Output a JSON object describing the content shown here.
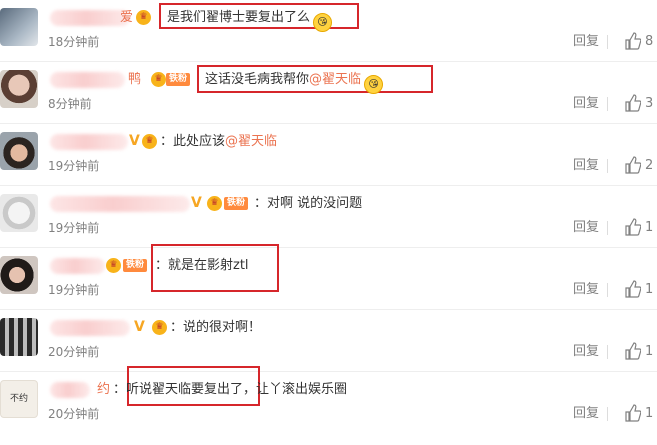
{
  "comments": [
    {
      "time": "18分钟前",
      "name_tail": "爱",
      "text_parts": [
        "是我们翟博士要复出了么"
      ],
      "emoji": "😘",
      "reply": "回复",
      "likes": "8",
      "highlighted": true
    },
    {
      "time": "8分钟前",
      "name_tail": "鸭",
      "fan_badge": "铁粉",
      "text_parts": [
        "这话没毛病我帮你"
      ],
      "mention": "@翟天临",
      "emoji": "😘",
      "reply": "回复",
      "likes": "3",
      "highlighted": true
    },
    {
      "time": "19分钟前",
      "name_tail": "V",
      "text_parts": [
        "：此处应该"
      ],
      "mention": "@翟天临",
      "reply": "回复",
      "likes": "2",
      "highlighted": false
    },
    {
      "time": "19分钟前",
      "name_tail": "V",
      "fan_badge": "铁粉",
      "text_parts": [
        "：对啊 说的没问题"
      ],
      "reply": "回复",
      "likes": "1",
      "highlighted": false
    },
    {
      "time": "19分钟前",
      "fan_badge": "铁粉",
      "text_parts": [
        "：就是在影射ztl"
      ],
      "reply": "回复",
      "likes": "1",
      "highlighted": true
    },
    {
      "time": "20分钟前",
      "name_tail": "V",
      "text_parts": [
        "：说的很对啊！"
      ],
      "reply": "回复",
      "likes": "1",
      "highlighted": false
    },
    {
      "time": "20分钟前",
      "name_tail": "约",
      "avatar_text": "不约",
      "text_parts": [
        "：听说翟天临要复出了",
        "，让丫滚出娱乐圈"
      ],
      "reply": "回复",
      "likes": "1",
      "highlighted": true
    }
  ],
  "colors": {
    "mention": "#eb7350",
    "highlight_box": "#d6262b",
    "meta_text": "#808080",
    "fan_badge": "#ff8a3d"
  }
}
